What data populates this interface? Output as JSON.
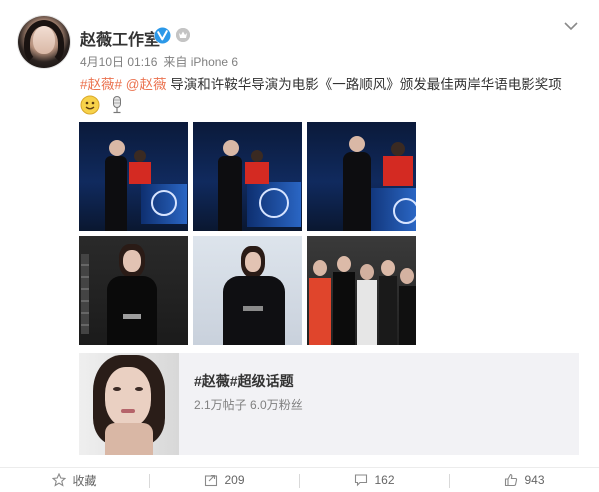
{
  "user": {
    "name": "赵薇工作室"
  },
  "post": {
    "date": "4月10日 01:16",
    "source": "来自 iPhone 6",
    "hashtag": "#赵薇#",
    "mention": "@赵薇",
    "text": " 导演和许鞍华导演为电影《一路顺风》颁发最佳两岸华语电影奖项"
  },
  "topic": {
    "title": "#赵薇#超级话题",
    "stats": "2.1万帖子 6.0万粉丝"
  },
  "actions": {
    "favorite_label": "收藏",
    "repost_count": "209",
    "comment_count": "162",
    "like_count": "943"
  },
  "colors": {
    "link": "#eb7350",
    "verified": "#2b98e8",
    "stage_blue": "#16418a"
  }
}
